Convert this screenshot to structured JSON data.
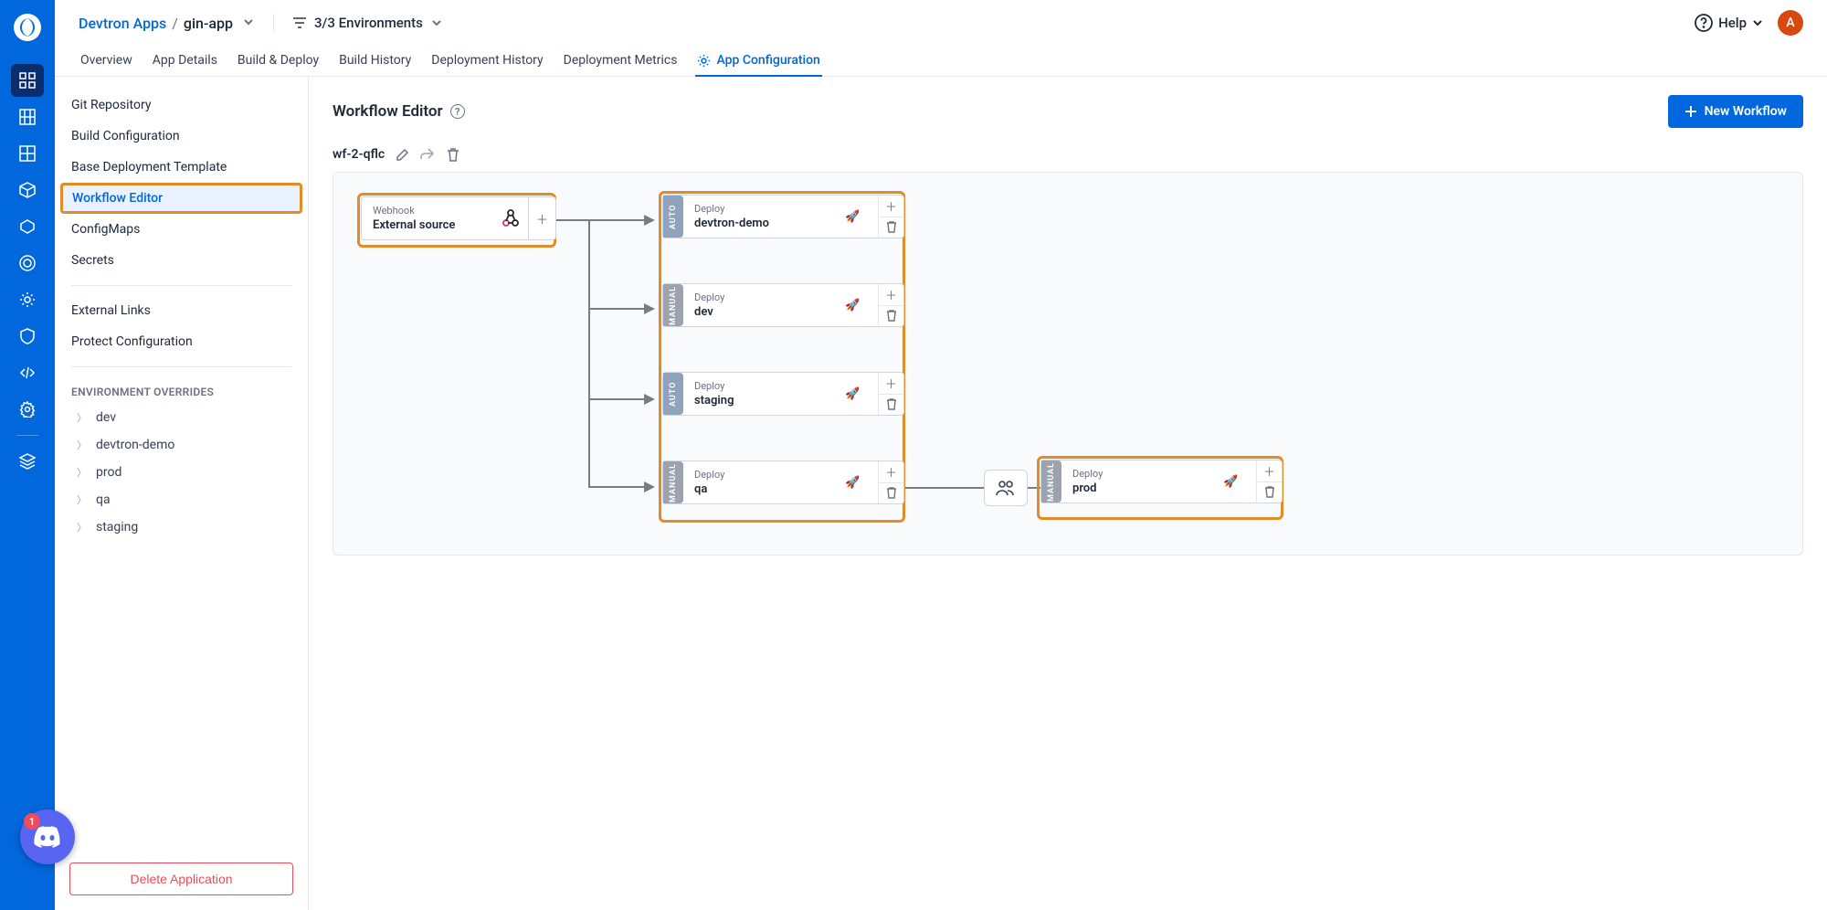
{
  "breadcrumb": {
    "parent": "Devtron Apps",
    "current": "gin-app"
  },
  "envFilter": "3/3 Environments",
  "help": "Help",
  "avatar": "A",
  "tabs": [
    {
      "label": "Overview",
      "active": false
    },
    {
      "label": "App Details",
      "active": false
    },
    {
      "label": "Build & Deploy",
      "active": false
    },
    {
      "label": "Build History",
      "active": false
    },
    {
      "label": "Deployment History",
      "active": false
    },
    {
      "label": "Deployment Metrics",
      "active": false
    },
    {
      "label": "App Configuration",
      "active": true
    }
  ],
  "sidebar": {
    "items": [
      "Git Repository",
      "Build Configuration",
      "Base Deployment Template",
      "Workflow Editor",
      "ConfigMaps",
      "Secrets"
    ],
    "highlightedIndex": 3,
    "section2": [
      "External Links",
      "Protect Configuration"
    ],
    "envHeading": "ENVIRONMENT OVERRIDES",
    "envs": [
      "dev",
      "devtron-demo",
      "prod",
      "qa",
      "staging"
    ],
    "deleteLabel": "Delete Application"
  },
  "canvas": {
    "title": "Workflow Editor",
    "newBtn": "New Workflow",
    "wfName": "wf-2-qflc"
  },
  "source": {
    "label": "Webhook",
    "title": "External source"
  },
  "deploys": [
    {
      "mode": "AUTO",
      "label": "Deploy",
      "env": "devtron-demo"
    },
    {
      "mode": "MANUAL",
      "label": "Deploy",
      "env": "dev"
    },
    {
      "mode": "AUTO",
      "label": "Deploy",
      "env": "staging"
    },
    {
      "mode": "MANUAL",
      "label": "Deploy",
      "env": "qa"
    }
  ],
  "prod": {
    "mode": "MANUAL",
    "label": "Deploy",
    "env": "prod"
  },
  "discord": {
    "badge": "1"
  }
}
